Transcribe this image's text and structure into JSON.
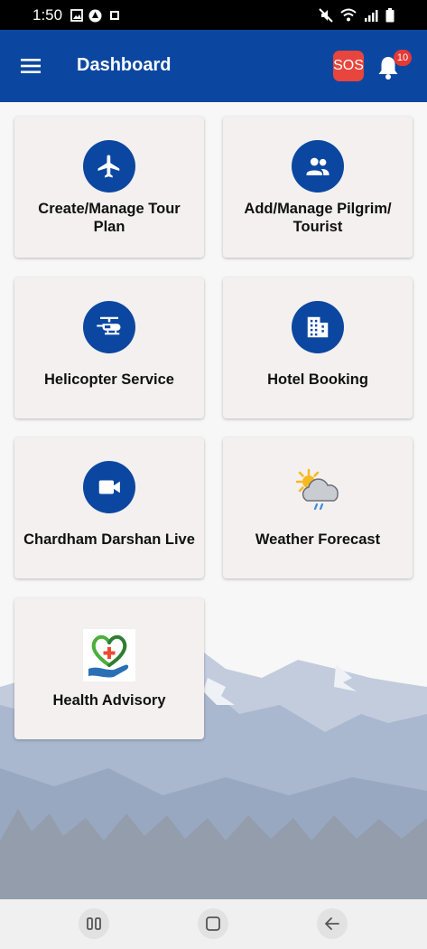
{
  "status_bar": {
    "time": "1:50",
    "left_icons": [
      "image-icon",
      "drive-icon",
      "app-logo-icon"
    ],
    "right_icons": [
      "mute-icon",
      "wifi-icon",
      "signal-icon",
      "battery-icon"
    ]
  },
  "app_bar": {
    "title": "Dashboard",
    "sos_label": "SOS",
    "notification_count": "10",
    "background_color": "#0b47a1"
  },
  "tiles": [
    {
      "label": "Create/Manage Tour Plan",
      "icon": "airplane-icon"
    },
    {
      "label": "Add/Manage Pilgrim/ Tourist",
      "icon": "people-icon"
    },
    {
      "label": "Helicopter Service",
      "icon": "helicopter-icon"
    },
    {
      "label": "Hotel Booking",
      "icon": "building-icon"
    },
    {
      "label": "Chardham Darshan Live",
      "icon": "videocam-icon"
    },
    {
      "label": "Weather Forecast",
      "icon": "weather-icon"
    },
    {
      "label": "Health Advisory",
      "icon": "health-icon"
    }
  ],
  "nav_bar": {
    "buttons": [
      "recent-apps-icon",
      "home-icon",
      "back-icon"
    ]
  },
  "colors": {
    "primary": "#0b47a1",
    "sos": "#e7453d",
    "badge": "#e53935",
    "card": "#f3f0ef"
  }
}
